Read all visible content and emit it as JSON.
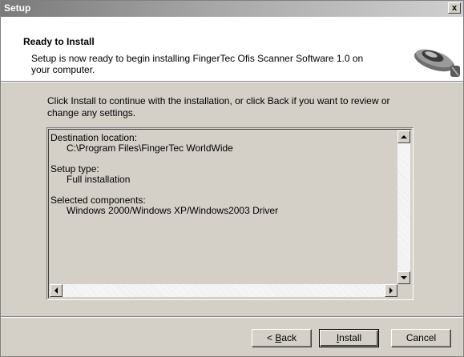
{
  "window": {
    "title": "Setup",
    "close_label": "x"
  },
  "header": {
    "title": "Ready to Install",
    "description": "Setup is now ready to begin installing FingerTec Ofis Scanner Software 1.0 on your computer.",
    "icon": "fingerprint-scanner-icon"
  },
  "intro": "Click Install to continue with the installation, or click Back if you want to review or change any settings.",
  "summary": {
    "destination_heading": "Destination location:",
    "destination_value": "C:\\Program Files\\FingerTec WorldWide",
    "setup_type_heading": "Setup type:",
    "setup_type_value": "Full installation",
    "components_heading": "Selected components:",
    "components_value": "Windows 2000/Windows XP/Windows2003 Driver"
  },
  "buttons": {
    "back_prefix": "< ",
    "back_ul": "B",
    "back_rest": "ack",
    "install_ul": "I",
    "install_rest": "nstall",
    "cancel": "Cancel"
  }
}
